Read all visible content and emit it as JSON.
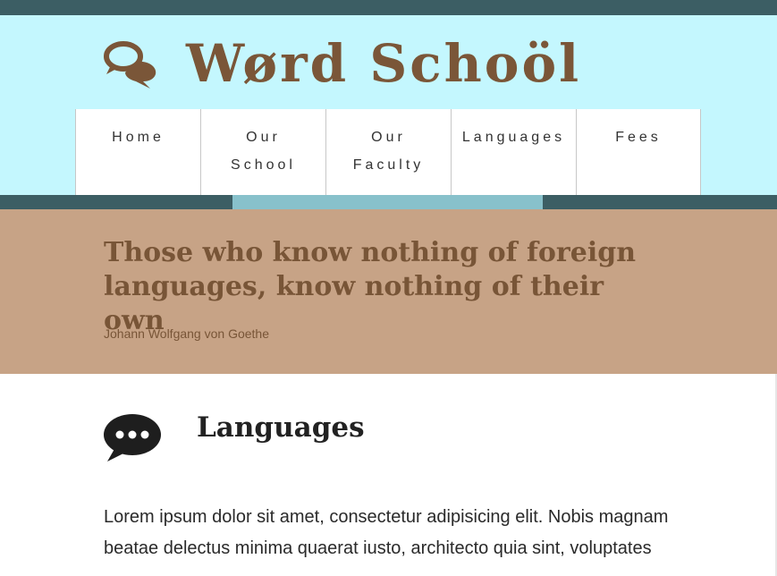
{
  "header": {
    "logo_text": "Wørd Schoöl",
    "logo_icon": "chat-bubbles-icon"
  },
  "nav": {
    "items": [
      {
        "label": "Home"
      },
      {
        "label": "Our School"
      },
      {
        "label": "Our Faculty"
      },
      {
        "label": "Languages"
      },
      {
        "label": "Fees"
      }
    ]
  },
  "quote": {
    "text": "Those who know nothing of foreign languages, know nothing of their own",
    "author": "Johann Wolfgang von Goethe"
  },
  "section": {
    "icon": "speech-bubble-dots-icon",
    "title": "Languages",
    "body": "Lorem ipsum dolor sit amet, consectetur adipisicing elit. Nobis magnam beatae delectus minima quaerat iusto, architecto quia sint, voluptates"
  },
  "colors": {
    "top_bar": "#3c5e64",
    "header_bg": "#c4f7fe",
    "brand_brown": "#7a5638",
    "stripe_accent": "#88c1cb",
    "quote_bg": "#c7a386"
  }
}
